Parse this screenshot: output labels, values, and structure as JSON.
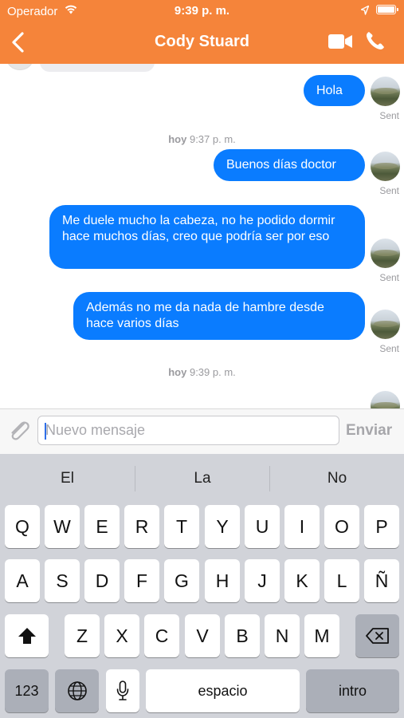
{
  "status": {
    "carrier": "Operador",
    "time": "9:39 p. m."
  },
  "nav": {
    "title": "Cody Stuard"
  },
  "messages": [
    {
      "text": "Hola",
      "status": "Sent"
    },
    {
      "text": "Buenos días doctor",
      "status": "Sent"
    },
    {
      "text": "Me duele mucho la cabeza, no he podido dormir hace muchos días, creo que podría ser por eso",
      "status": "Sent"
    },
    {
      "text": "Además no me da nada de hambre desde hace varios días",
      "status": "Sent"
    }
  ],
  "timestamps": [
    {
      "day": "hoy",
      "time": "9:37 p. m."
    },
    {
      "day": "hoy",
      "time": "9:39 p. m."
    }
  ],
  "input": {
    "placeholder": "Nuevo mensaje",
    "value": "",
    "send_label": "Enviar"
  },
  "keyboard": {
    "suggestions": [
      "El",
      "La",
      "No"
    ],
    "row1": [
      "Q",
      "W",
      "E",
      "R",
      "T",
      "Y",
      "U",
      "I",
      "O",
      "P"
    ],
    "row2": [
      "A",
      "S",
      "D",
      "F",
      "G",
      "H",
      "J",
      "K",
      "L",
      "Ñ"
    ],
    "row3": [
      "Z",
      "X",
      "C",
      "V",
      "B",
      "N",
      "M"
    ],
    "numbers_label": "123",
    "space_label": "espacio",
    "return_label": "intro"
  },
  "icons": {
    "back": "chevron-left-icon",
    "video": "video-camera-icon",
    "phone": "phone-icon",
    "attach": "paperclip-icon",
    "shift": "shift-icon",
    "delete": "delete-icon",
    "globe": "globe-icon",
    "mic": "microphone-icon"
  },
  "colors": {
    "nav_bar": "#f5843a",
    "bubble": "#0a7cff",
    "keyboard": "#d1d3d9"
  }
}
